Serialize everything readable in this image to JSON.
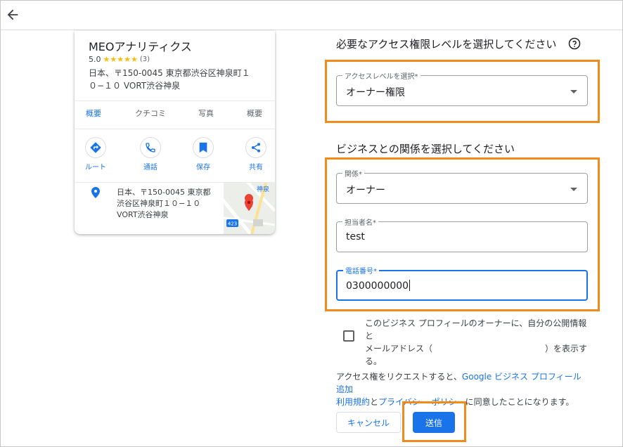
{
  "business_card": {
    "name": "MEOアナリティクス",
    "rating": "5.0",
    "stars": "★★★★★",
    "review_count": "(3)",
    "address_line1": "日本、〒150-0045 東京都渋谷区神泉町１",
    "address_line2": "０−１０ VORT渋谷神泉",
    "tabs": [
      "概要",
      "クチコミ",
      "写真",
      "概要"
    ],
    "actions": [
      "ルート",
      "通話",
      "保存",
      "共有"
    ],
    "detail_address_line1": "日本、〒150-0045 東京都",
    "detail_address_line2": "渋谷区神泉町１０−１０",
    "detail_address_line3": "VORT渋谷神泉",
    "map_labels": {
      "station": "神泉",
      "route": "423"
    }
  },
  "form": {
    "access_title": "必要なアクセス権限レベルを選択してください",
    "access_field": {
      "label": "アクセスレベルを選択*",
      "value": "オーナー権限"
    },
    "relation_title": "ビジネスとの関係を選択してください",
    "relation_field": {
      "label": "関係*",
      "value": "オーナー"
    },
    "contact_field": {
      "label": "担当者名*",
      "value": "test"
    },
    "phone_field": {
      "label": "電話番号*",
      "value": "0300000000"
    },
    "checkbox_text_a": "このビジネス プロフィールのオーナーに、自分の公開情報と",
    "checkbox_text_b": "メールアドレス（",
    "checkbox_text_c": "）を表示す",
    "checkbox_text_d": "る。",
    "terms_prefix": "アクセス権をリクエストすると、",
    "terms_link1": "Google ビジネス プロフィール追加",
    "terms_link1b": "利用規約",
    "terms_mid": "と",
    "terms_link2": "プライバシー ポリシー",
    "terms_suffix": "に同意したことになります。",
    "cancel_label": "キャンセル",
    "submit_label": "送信"
  },
  "colors": {
    "accent": "#1a73e8",
    "highlight": "#f28a1c",
    "star": "#fbbc04"
  }
}
